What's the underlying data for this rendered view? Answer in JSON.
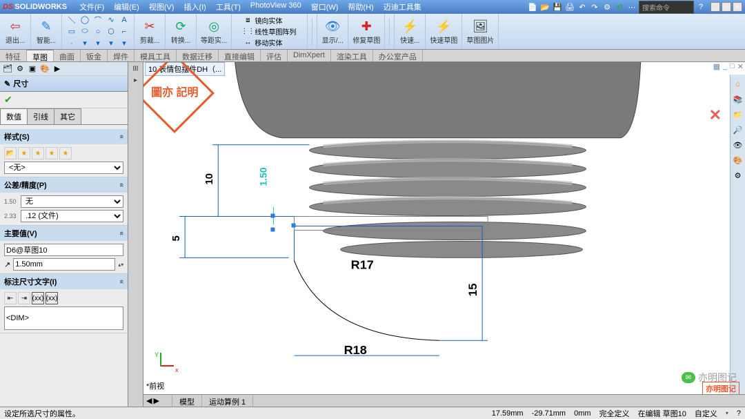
{
  "app": {
    "name": "SOLIDWORKS"
  },
  "menu": [
    "文件(F)",
    "编辑(E)",
    "视图(V)",
    "插入(I)",
    "工具(T)",
    "PhotoView 360",
    "窗口(W)",
    "帮助(H)",
    "迈迪工具集"
  ],
  "searchCmd": "搜索命令",
  "ribbon": {
    "exit": "退出...",
    "smart": "智能...",
    "trim": "剪裁...",
    "convert": "转换...",
    "offset": "等距实...",
    "mirror": "镜向实体",
    "linear": "线性草图阵列",
    "move": "移动实体",
    "display": "显示/...",
    "repair": "修复草图",
    "quick": "快速...",
    "quick2": "快速草图",
    "pic": "草图图片"
  },
  "tabs": [
    "特征",
    "草图",
    "曲面",
    "钣金",
    "焊件",
    "模具工具",
    "数据迁移",
    "直接编辑",
    "评估",
    "DimXpert",
    "渲染工具",
    "办公室产品"
  ],
  "activeTab": "草图",
  "docTitle": "10.表情包摆件DH（...",
  "leftpanel": {
    "title": "尺寸",
    "subtabs": [
      "数值",
      "引线",
      "其它"
    ],
    "activeSubtab": "数值",
    "style": {
      "label": "样式(S)",
      "value": "<无>"
    },
    "tol": {
      "label": "公差/精度(P)",
      "tol": "无",
      "prec": ".12 (文件)"
    },
    "primary": {
      "label": "主要值(V)",
      "name": "D6@草图10",
      "value": "1.50mm"
    },
    "dimtext": {
      "label": "标注尺寸文字(I)",
      "token": "<DIM>"
    }
  },
  "dimensions": {
    "d10": "10",
    "d5": "5",
    "d150": "1.50",
    "r17": "R17",
    "r18": "R18",
    "d15": "15"
  },
  "viewLabel": "*前视",
  "bottomTabs": [
    "模型",
    "运动算例 1"
  ],
  "status": {
    "hint": "设定所选尺寸的属性。",
    "x": "17.59mm",
    "y": "-29.71mm",
    "z": "0mm",
    "def": "完全定义",
    "edit": "在编辑 草图10",
    "custom": "自定义"
  },
  "watermarkText": "亦明图记",
  "stampText": "圖亦\n記明"
}
